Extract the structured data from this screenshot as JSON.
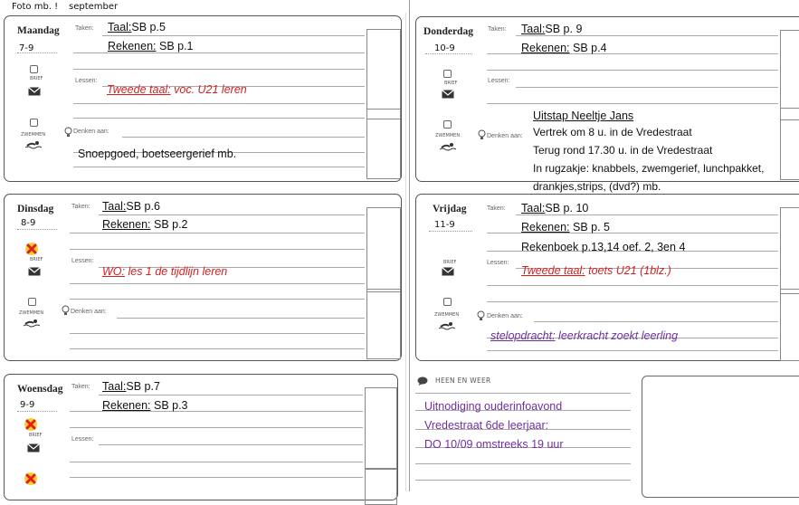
{
  "header": {
    "left": "Foto mb. !",
    "right": "september"
  },
  "labels": {
    "taken": "Taken:",
    "lessen": "Lessen:",
    "denken": "Denken aan:",
    "brief": "BRIEF",
    "zwemmen": "ZWEMMEN",
    "heen": "HEEN EN WEER"
  },
  "days": [
    {
      "name": "Maandag",
      "date": "7-9",
      "taken1_label": "Taal:",
      "taken1_value": "SB p.5",
      "taken2_label": "Rekenen:",
      "taken2_value": " SB p.1",
      "lessen_label": "Tweede taal:",
      "lessen_value": " voc. U21 leren",
      "denken": "Snoepgoed, boetseergerief mb."
    },
    {
      "name": "Dinsdag",
      "date": "8-9",
      "taken1_label": "Taal:",
      "taken1_value": "SB p.6",
      "taken2_label": "Rekenen:",
      "taken2_value": " SB p.2",
      "lessen_label": "WO:",
      "lessen_value": " les 1 de tijdlijn leren"
    },
    {
      "name": "Woensdag",
      "date": "9-9",
      "taken1_label": "Taal:",
      "taken1_value": "SB p.7",
      "taken2_label": "Rekenen:",
      "taken2_value": " SB p.3"
    },
    {
      "name": "Donderdag",
      "date": "10-9",
      "taken1_label": "Taal:",
      "taken1_value": "SB p. 9",
      "taken2_label": "Rekenen:",
      "taken2_value": " SB p.4",
      "denken_title": "Uitstap Neeltje Jans",
      "denken_lines": [
        "Vertrek om 8 u. in de Vredestraat",
        "Terug rond 17.30 u. in de Vredestraat",
        "In rugzakje: knabbels, zwemgerief, lunchpakket,",
        "drankjes,strips, (dvd?) mb."
      ]
    },
    {
      "name": "Vrijdag",
      "date": "11-9",
      "taken1_label": "Taal:",
      "taken1_value": "SB p. 10",
      "taken2_label": "Rekenen:",
      "taken2_value": " SB p. 5",
      "taken3": "Rekenboek p.13,14 oef. 2, 3en 4",
      "lessen_label": "Tweede taal:",
      "lessen_value": " toets U21 (1blz.)",
      "denken_label": "stelopdracht:",
      "denken_value": " leerkracht zoekt leerling"
    }
  ],
  "heen_en_weer": [
    "Uitnodiging ouderinfoavond",
    "Vredestraat 6de leerjaar:",
    "DO 10/09 omstreeks 19 uur"
  ],
  "colors": {
    "red": "#d32020",
    "purple": "#7030a0"
  }
}
